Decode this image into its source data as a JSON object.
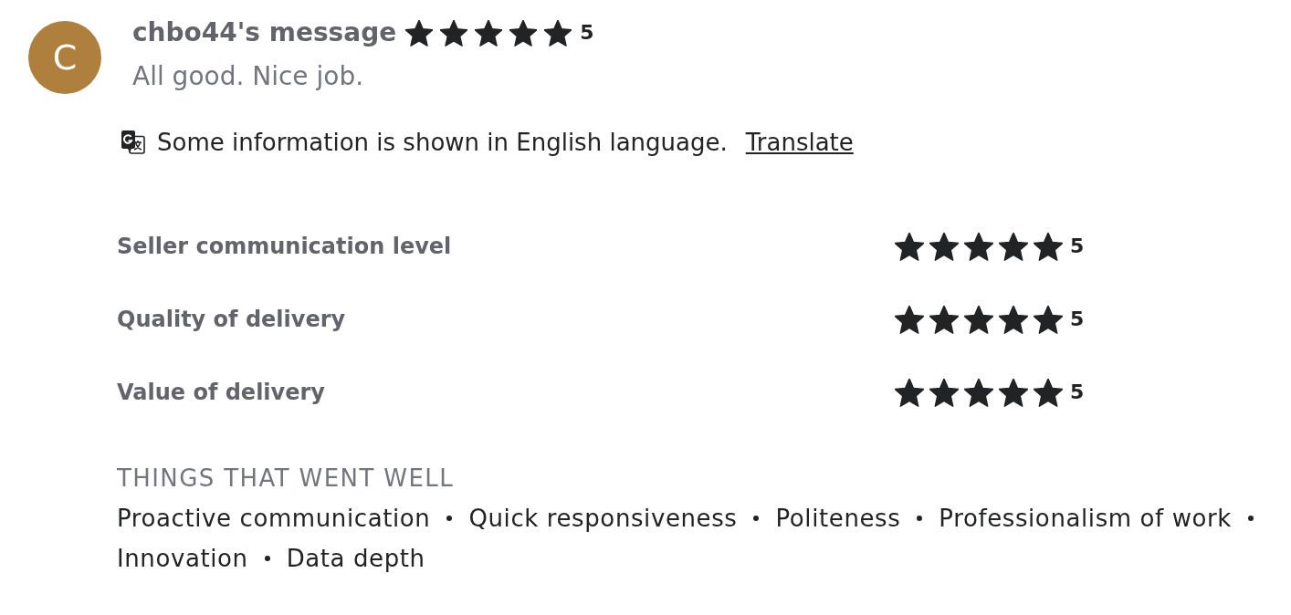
{
  "review": {
    "avatar_initial": "C",
    "title": "chbo44's message",
    "stars": 5,
    "score": "5",
    "message": "All good. Nice job."
  },
  "translation_notice": {
    "text": "Some information is shown in English language.",
    "link": "Translate"
  },
  "ratings": [
    {
      "label": "Seller communication level",
      "stars": 5,
      "score": "5"
    },
    {
      "label": "Quality of delivery",
      "stars": 5,
      "score": "5"
    },
    {
      "label": "Value of delivery",
      "stars": 5,
      "score": "5"
    }
  ],
  "highlights": {
    "heading": "THINGS THAT WENT WELL",
    "tags": [
      "Proactive communication",
      "Quick responsiveness",
      "Politeness",
      "Professionalism of work",
      "Innovation",
      "Data depth"
    ]
  }
}
